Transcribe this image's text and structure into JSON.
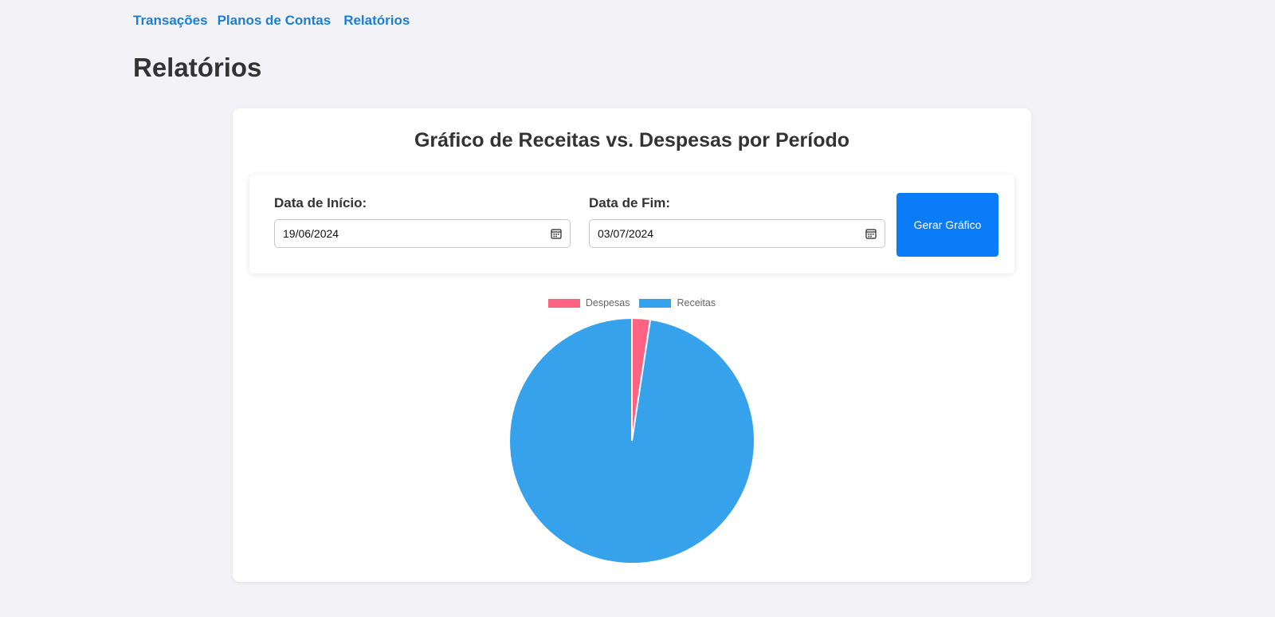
{
  "nav": {
    "items": [
      {
        "label": "Transações"
      },
      {
        "label": "Planos de Contas"
      },
      {
        "label": "Relatórios"
      }
    ]
  },
  "page": {
    "title": "Relatórios"
  },
  "report": {
    "title": "Gráfico de Receitas vs. Despesas por Período",
    "start_label": "Data de Início:",
    "start_value": "19/06/2024",
    "end_label": "Data de Fim:",
    "end_value": "03/07/2024",
    "generate_label": "Gerar Gráfico"
  },
  "colors": {
    "link": "#1a7fd6",
    "button": "#0a7cf8",
    "despesas": "#ff6384",
    "receitas": "#36a2eb"
  },
  "icons": {
    "date_picker": "calendar-icon"
  },
  "chart_data": {
    "type": "pie",
    "title": "",
    "categories": [
      "Despesas",
      "Receitas"
    ],
    "values": [
      2.4,
      97.6
    ],
    "colors": [
      "#ff6384",
      "#36a2eb"
    ],
    "legend": "top"
  }
}
